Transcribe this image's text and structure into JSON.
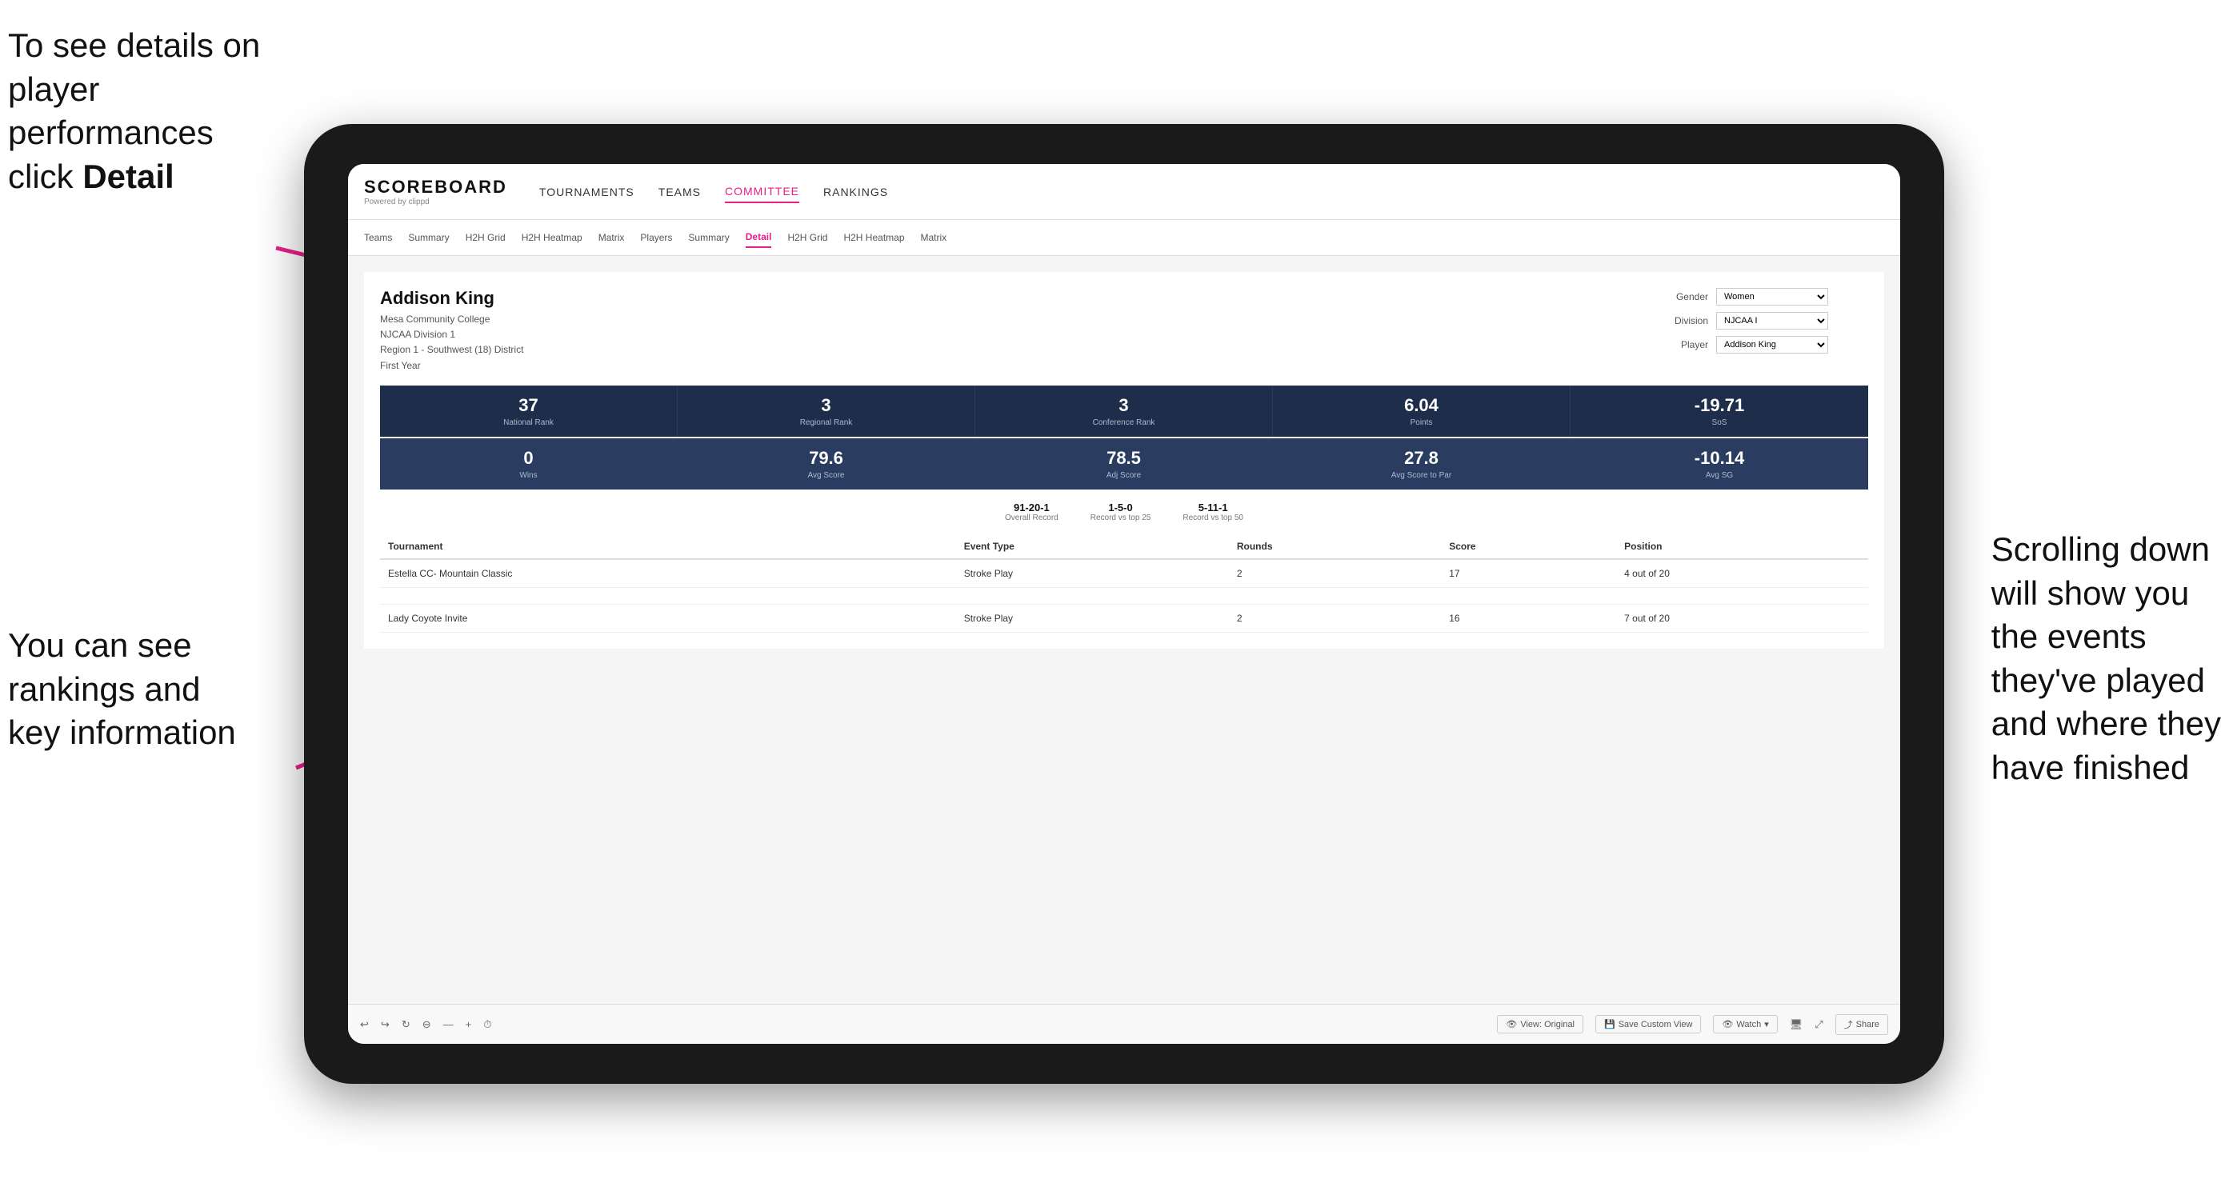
{
  "annotations": {
    "top_left": {
      "line1": "To see details on",
      "line2": "player performances",
      "line3_prefix": "click ",
      "line3_bold": "Detail"
    },
    "bottom_left": {
      "line1": "You can see",
      "line2": "rankings and",
      "line3": "key information"
    },
    "right": {
      "line1": "Scrolling down",
      "line2": "will show you",
      "line3": "the events",
      "line4": "they've played",
      "line5": "and where they",
      "line6": "have finished"
    }
  },
  "app": {
    "logo": "SCOREBOARD",
    "logo_sub": "Powered by clippd",
    "main_nav": [
      "TOURNAMENTS",
      "TEAMS",
      "COMMITTEE",
      "RANKINGS"
    ],
    "active_main_nav": "COMMITTEE",
    "sub_nav": [
      "Teams",
      "Summary",
      "H2H Grid",
      "H2H Heatmap",
      "Matrix",
      "Players",
      "Summary",
      "Detail",
      "H2H Grid",
      "H2H Heatmap",
      "Matrix"
    ],
    "active_sub_nav": "Detail"
  },
  "player": {
    "name": "Addison King",
    "college": "Mesa Community College",
    "division": "NJCAA Division 1",
    "region": "Region 1 - Southwest (18) District",
    "year": "First Year"
  },
  "filters": {
    "gender_label": "Gender",
    "gender_value": "Women",
    "division_label": "Division",
    "division_value": "NJCAA I",
    "player_label": "Player",
    "player_value": "Addison King"
  },
  "stats_row1": [
    {
      "value": "37",
      "label": "National Rank"
    },
    {
      "value": "3",
      "label": "Regional Rank"
    },
    {
      "value": "3",
      "label": "Conference Rank"
    },
    {
      "value": "6.04",
      "label": "Points"
    },
    {
      "value": "-19.71",
      "label": "SoS"
    }
  ],
  "stats_row2": [
    {
      "value": "0",
      "label": "Wins"
    },
    {
      "value": "79.6",
      "label": "Avg Score"
    },
    {
      "value": "78.5",
      "label": "Adj Score"
    },
    {
      "value": "27.8",
      "label": "Avg Score to Par"
    },
    {
      "value": "-10.14",
      "label": "Avg SG"
    }
  ],
  "records": [
    {
      "value": "91-20-1",
      "label": "Overall Record"
    },
    {
      "value": "1-5-0",
      "label": "Record vs top 25"
    },
    {
      "value": "5-11-1",
      "label": "Record vs top 50"
    }
  ],
  "table": {
    "headers": [
      "Tournament",
      "Event Type",
      "Rounds",
      "Score",
      "Position"
    ],
    "rows": [
      {
        "tournament": "Estella CC- Mountain Classic",
        "event_type": "Stroke Play",
        "rounds": "2",
        "score": "17",
        "position": "4 out of 20"
      },
      {
        "tournament": "",
        "event_type": "",
        "rounds": "",
        "score": "",
        "position": ""
      },
      {
        "tournament": "Lady Coyote Invite",
        "event_type": "Stroke Play",
        "rounds": "2",
        "score": "16",
        "position": "7 out of 20"
      }
    ]
  },
  "toolbar": {
    "buttons": [
      "View: Original",
      "Save Custom View",
      "Watch",
      "Share"
    ],
    "icons": [
      "undo",
      "redo",
      "refresh",
      "zoom-out",
      "minus",
      "plus",
      "clock",
      "eye",
      "save",
      "eye-2",
      "monitor",
      "expand",
      "share"
    ]
  }
}
